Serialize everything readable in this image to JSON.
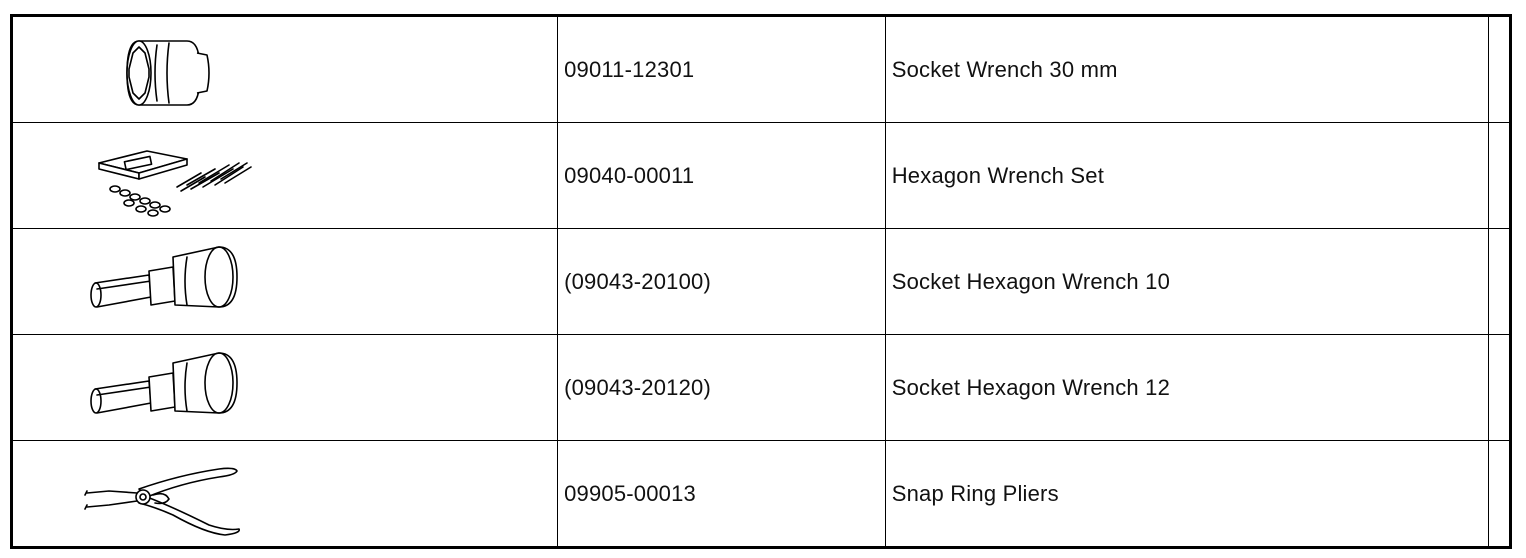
{
  "tools": [
    {
      "icon": "socket-wrench-icon",
      "part_number": "09011-12301",
      "name": "Socket Wrench 30 mm"
    },
    {
      "icon": "hexagon-wrench-set-icon",
      "part_number": "09040-00011",
      "name": "Hexagon Wrench Set"
    },
    {
      "icon": "socket-hexagon-wrench-icon",
      "part_number": "(09043-20100)",
      "name": "Socket Hexagon Wrench 10"
    },
    {
      "icon": "socket-hexagon-wrench-icon",
      "part_number": "(09043-20120)",
      "name": "Socket Hexagon Wrench 12"
    },
    {
      "icon": "snap-ring-pliers-icon",
      "part_number": "09905-00013",
      "name": "Snap Ring Pliers"
    }
  ]
}
